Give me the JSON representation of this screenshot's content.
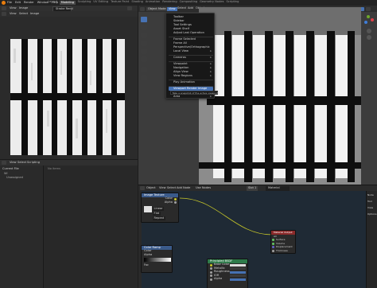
{
  "app": {
    "menus": [
      "File",
      "Edit",
      "Render",
      "Window",
      "Help"
    ],
    "workspace_tabs": [
      "Layout",
      "Modeling",
      "Sculpting",
      "UV Editing",
      "Texture Paint",
      "Shading",
      "Animation",
      "Rendering",
      "Compositing",
      "Geometry Nodes",
      "Scripting"
    ],
    "active_tab": "Modeling"
  },
  "image_editor": {
    "header_items": [
      "View",
      "Image"
    ],
    "image_name": "Stroke Rend",
    "uv_menus": [
      "View",
      "Select",
      "Image"
    ]
  },
  "outliner": {
    "header_items": [
      "View",
      "Select",
      "Scripting"
    ],
    "tree_label": "Current File",
    "rows": [
      "Wi",
      "Unassigned"
    ],
    "right_label": "No items"
  },
  "viewport": {
    "mode": "Object Mode",
    "header_menus": [
      "View",
      "Select",
      "Add",
      "Object"
    ],
    "orientation": "Global",
    "active_menu": "View"
  },
  "view_menu": {
    "items": [
      {
        "label": "Toolbar",
        "arrow": false
      },
      {
        "label": "Sidebar",
        "arrow": false
      },
      {
        "label": "Tool Settings",
        "arrow": false
      },
      {
        "label": "Asset Shelf",
        "arrow": false
      },
      {
        "label": "Adjust Last Operation",
        "arrow": false
      },
      {
        "label": "",
        "arrow": false
      },
      {
        "label": "Frame Selected",
        "arrow": false
      },
      {
        "label": "Frame All",
        "arrow": false
      },
      {
        "label": "Perspective/Orthographic",
        "arrow": false
      },
      {
        "label": "Local View",
        "arrow": true
      },
      {
        "label": "",
        "arrow": false
      },
      {
        "label": "Cameras",
        "arrow": true
      },
      {
        "label": "",
        "arrow": false
      },
      {
        "label": "Viewpoint",
        "arrow": true
      },
      {
        "label": "Navigation",
        "arrow": true
      },
      {
        "label": "Align View",
        "arrow": true
      },
      {
        "label": "View Regions",
        "arrow": true
      },
      {
        "label": "",
        "arrow": false
      },
      {
        "label": "Play Animation",
        "arrow": false
      },
      {
        "label": "",
        "arrow": false
      },
      {
        "label": "Viewport Render Image",
        "arrow": false
      },
      {
        "label": "Viewport Render Animation",
        "arrow": false
      },
      {
        "label": "Area",
        "arrow": true
      }
    ],
    "highlighted_index": 20,
    "tooltip": "Take a snapshot of the active viewport"
  },
  "node_editor": {
    "header_items": [
      "Object",
      "View",
      "Select",
      "Add",
      "Node",
      "Use Nodes"
    ],
    "material_name": "Slot 1",
    "material_field": "Material",
    "image_node": {
      "title": "Image Texture",
      "outputs": [
        "Color",
        "Alpha"
      ],
      "fields": [
        "Linear",
        "Flat",
        "Repeat"
      ]
    },
    "output_node": {
      "title": "Material Output",
      "field": "All",
      "inputs": [
        "Surface",
        "Volume",
        "Displacement",
        "Thickness"
      ]
    },
    "bsdf_node": {
      "title": "Principled BSDF",
      "rows": [
        "Base Color",
        "Metallic",
        "Roughness",
        "IOR",
        "Alpha"
      ]
    },
    "ramp_node": {
      "title": "Color Ramp",
      "rows": [
        "Color",
        "Alpha",
        "Fac"
      ]
    },
    "sidebar_tabs": [
      "Node",
      "Tool",
      "View",
      "Options"
    ]
  },
  "colors": {
    "accent": "#4772b3",
    "header": "#303030",
    "panel": "#282828",
    "node_editor_bg": "#1f2a35",
    "shader_green": "#2e7a4a",
    "output_red": "#8b2a2a",
    "image_node_blue": "#3a5a8a"
  }
}
